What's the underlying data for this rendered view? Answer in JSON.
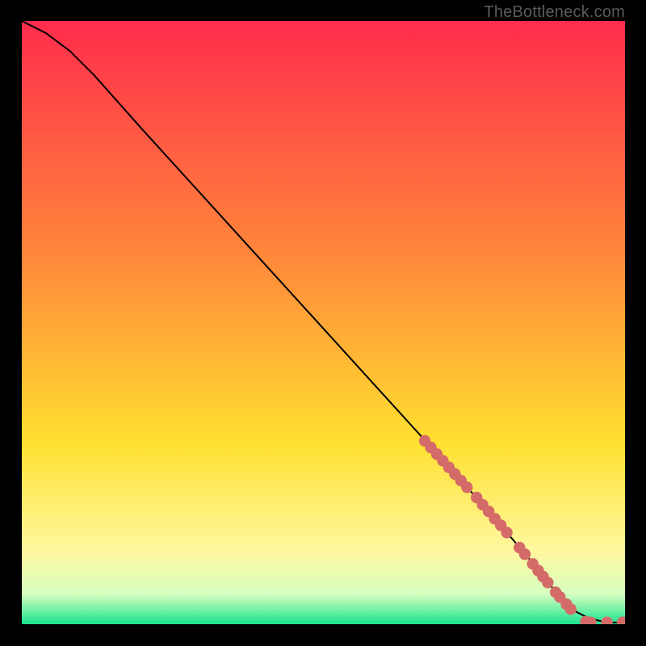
{
  "watermark": "TheBottleneck.com",
  "colors": {
    "gradient_top": "#ff2c4c",
    "gradient_mid1": "#ff8a3a",
    "gradient_mid2": "#ffe030",
    "gradient_mid3": "#fff8a0",
    "gradient_mid4": "#d7ffc0",
    "gradient_bottom": "#19e38f",
    "line": "#000000",
    "dot": "#d46b68",
    "dot_stroke": "#c85f5c"
  },
  "chart_data": {
    "type": "line",
    "title": "",
    "xlabel": "",
    "ylabel": "",
    "xlim": [
      0,
      100
    ],
    "ylim": [
      0,
      100
    ],
    "line": {
      "x": [
        0,
        4,
        8,
        12,
        20,
        30,
        40,
        50,
        60,
        70,
        78,
        84,
        88,
        90,
        92,
        94,
        96,
        98,
        100
      ],
      "y": [
        100,
        98,
        95,
        91,
        82,
        71,
        60,
        49,
        38,
        27,
        18,
        11,
        6,
        4,
        2,
        1,
        0.5,
        0.3,
        0.2
      ]
    },
    "dots": [
      {
        "x": 66.8,
        "y": 30.4
      },
      {
        "x": 67.8,
        "y": 29.3
      },
      {
        "x": 68.8,
        "y": 28.2
      },
      {
        "x": 69.8,
        "y": 27.1
      },
      {
        "x": 70.8,
        "y": 26.0
      },
      {
        "x": 71.8,
        "y": 24.9
      },
      {
        "x": 72.8,
        "y": 23.8
      },
      {
        "x": 73.8,
        "y": 22.7
      },
      {
        "x": 75.4,
        "y": 21.0
      },
      {
        "x": 76.4,
        "y": 19.8
      },
      {
        "x": 77.4,
        "y": 18.7
      },
      {
        "x": 78.4,
        "y": 17.5
      },
      {
        "x": 79.4,
        "y": 16.4
      },
      {
        "x": 80.4,
        "y": 15.2
      },
      {
        "x": 82.5,
        "y": 12.7
      },
      {
        "x": 83.4,
        "y": 11.6
      },
      {
        "x": 84.7,
        "y": 10.0
      },
      {
        "x": 85.6,
        "y": 8.9
      },
      {
        "x": 86.4,
        "y": 7.9
      },
      {
        "x": 87.2,
        "y": 6.9
      },
      {
        "x": 88.5,
        "y": 5.3
      },
      {
        "x": 89.2,
        "y": 4.5
      },
      {
        "x": 90.3,
        "y": 3.3
      },
      {
        "x": 91.0,
        "y": 2.5
      },
      {
        "x": 93.5,
        "y": 0.4
      },
      {
        "x": 94.3,
        "y": 0.3
      },
      {
        "x": 97.0,
        "y": 0.3
      },
      {
        "x": 99.6,
        "y": 0.3
      }
    ],
    "gradient_bands_y": [
      {
        "y": 100,
        "color": "gradient_top"
      },
      {
        "y": 60,
        "color": "gradient_mid1"
      },
      {
        "y": 30,
        "color": "gradient_mid2"
      },
      {
        "y": 12,
        "color": "gradient_mid3"
      },
      {
        "y": 5,
        "color": "gradient_mid4"
      },
      {
        "y": 0,
        "color": "gradient_bottom"
      }
    ]
  }
}
